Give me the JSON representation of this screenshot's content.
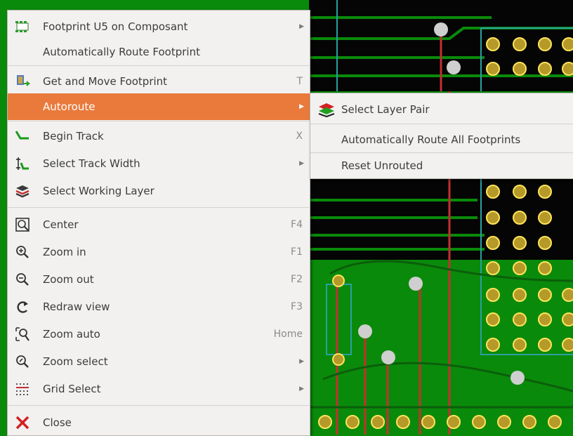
{
  "menu": {
    "items": [
      {
        "label": "Footprint U5 on Composant",
        "icon": "footprint-icon",
        "submenu": true
      },
      {
        "label": "Automatically Route Footprint"
      },
      {
        "label": "Get and Move Footprint",
        "shortcut": "T",
        "icon": "move-footprint-icon"
      },
      {
        "label": "Autoroute",
        "submenu": true,
        "active": true
      },
      {
        "label": "Begin Track",
        "shortcut": "X",
        "icon": "track-icon"
      },
      {
        "label": "Select Track Width",
        "icon": "track-width-icon",
        "submenu": true
      },
      {
        "label": "Select Working Layer",
        "icon": "layers-icon"
      },
      {
        "label": "Center",
        "shortcut": "F4",
        "icon": "center-icon"
      },
      {
        "label": "Zoom in",
        "shortcut": "F1",
        "icon": "zoom-in-icon"
      },
      {
        "label": "Zoom out",
        "shortcut": "F2",
        "icon": "zoom-out-icon"
      },
      {
        "label": "Redraw view",
        "shortcut": "F3",
        "icon": "redraw-icon"
      },
      {
        "label": "Zoom auto",
        "shortcut": "Home",
        "icon": "zoom-auto-icon"
      },
      {
        "label": "Zoom select",
        "icon": "zoom-select-icon",
        "submenu": true
      },
      {
        "label": "Grid Select",
        "icon": "grid-icon",
        "submenu": true
      },
      {
        "label": "Close",
        "icon": "close-icon"
      }
    ]
  },
  "submenu": {
    "items": [
      {
        "label": "Select Layer Pair",
        "icon": "layer-pair-icon"
      },
      {
        "label": "Automatically Route All Footprints"
      },
      {
        "label": "Reset Unrouted"
      }
    ]
  },
  "colors": {
    "highlight": "#e97a3c",
    "menu_bg": "#f2f1f0",
    "pcb_green": "#0a8a0a",
    "pcb_black": "#050505"
  }
}
